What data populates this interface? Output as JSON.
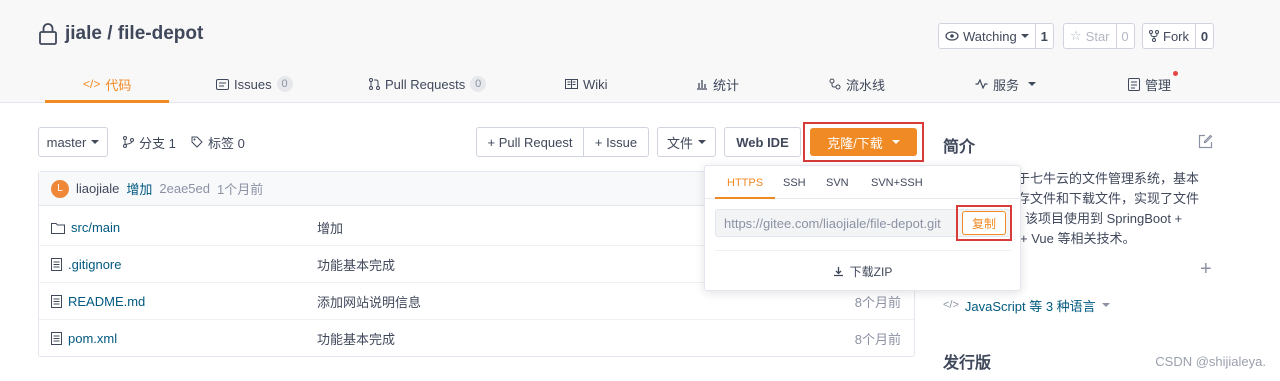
{
  "repo": {
    "name": "jiale / file-depot"
  },
  "social": {
    "watching_label": "Watching",
    "watching_count": "1",
    "star_label": "Star",
    "star_count": "0",
    "fork_label": "Fork",
    "fork_count": "0"
  },
  "tabs": [
    {
      "label": "代码",
      "icon": "code-icon",
      "active": true
    },
    {
      "label": "Issues",
      "badge": "0",
      "icon": "issues-icon"
    },
    {
      "label": "Pull Requests",
      "badge": "0",
      "icon": "pull-request-icon"
    },
    {
      "label": "Wiki",
      "icon": "wiki-icon"
    },
    {
      "label": "统计",
      "icon": "stats-icon"
    },
    {
      "label": "流水线",
      "icon": "pipeline-icon"
    },
    {
      "label": "服务",
      "icon": "service-icon"
    },
    {
      "label": "管理",
      "icon": "manage-icon"
    }
  ],
  "toolbar": {
    "branch": "master",
    "branch_count": "分支 1",
    "tag_count": "标签 0",
    "pull_request": "+ Pull Request",
    "issue": "+ Issue",
    "file": "文件",
    "web_ide": "Web IDE",
    "clone": "克隆/下载"
  },
  "commit": {
    "avatar_letter": "L",
    "author": "liaojiale",
    "message": "增加",
    "sha": "2eae5ed",
    "time": "1个月前"
  },
  "files": [
    {
      "name_prefix": "src/",
      "name": "main",
      "type": "folder",
      "message": "增加",
      "time": ""
    },
    {
      "name": ".gitignore",
      "type": "file",
      "message": "功能基本完成",
      "time": ""
    },
    {
      "name": "README.md",
      "type": "file",
      "message": "添加网站说明信息",
      "time": "8个月前"
    },
    {
      "name": "pom.xml",
      "type": "file",
      "message": "功能基本完成",
      "time": "8个月前"
    }
  ],
  "clone_popup": {
    "protocols": [
      "HTTPS",
      "SSH",
      "SVN",
      "SVN+SSH"
    ],
    "url": "https://gitee.com/liaojiale/file-depot.git",
    "copy": "复制",
    "download_zip": "下载ZIP"
  },
  "sidebar": {
    "intro_title": "简介",
    "description_lines": [
      "于七牛云的文件管理系统，基本",
      "存文件和下载文件，实现了文件",
      "该项目使用到 SpringBoot +",
      "+ Vue 等相关技术。"
    ],
    "languages": "JavaScript 等 3 种语言",
    "releases_title": "发行版"
  },
  "watermark": "CSDN @shijialeya.",
  "colors": {
    "accent": "#f08a24",
    "highlight_border": "#d93a3a",
    "link": "#005980"
  }
}
